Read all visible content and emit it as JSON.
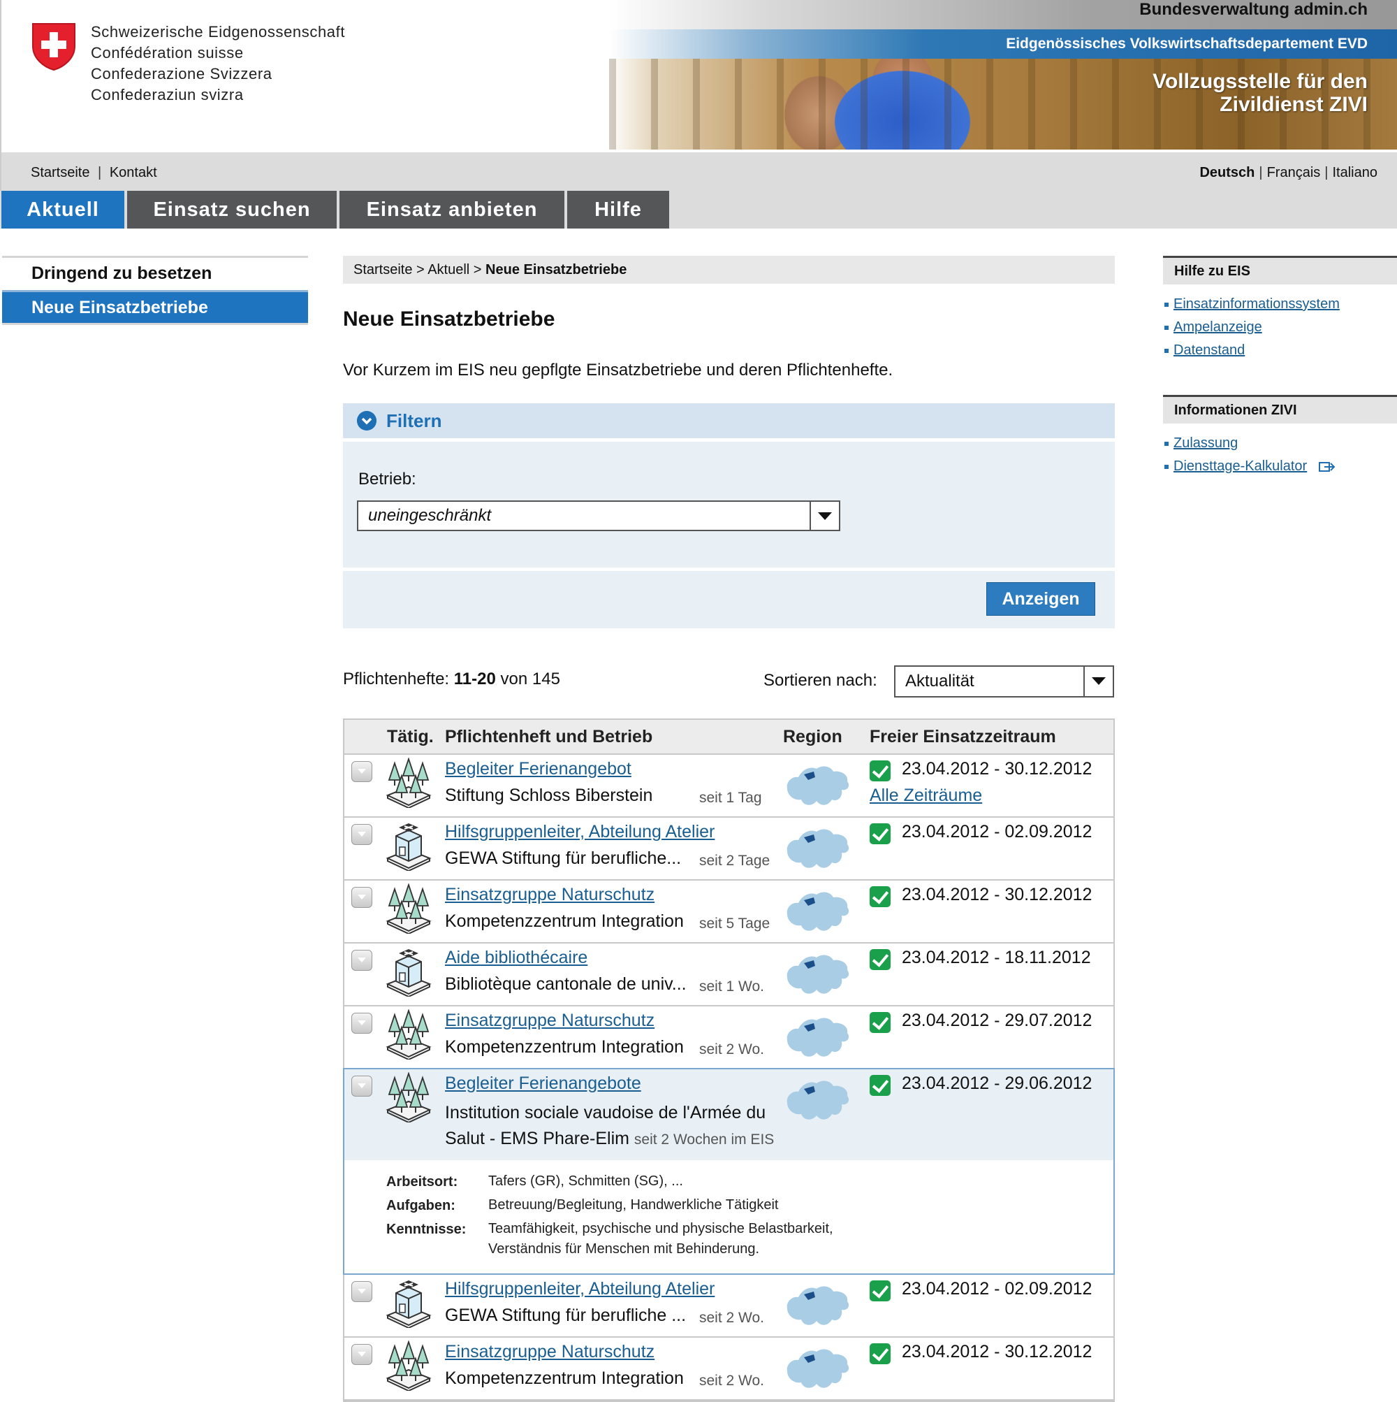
{
  "header": {
    "confederation": [
      "Schweizerische Eidgenossenschaft",
      "Confédération suisse",
      "Confederazione Svizzera",
      "Confederaziun svizra"
    ],
    "admin": "Bundesverwaltung admin.ch",
    "department": "Eidgenössisches Volkswirtschaftsdepartement EVD",
    "office_line1": "Vollzugsstelle für den",
    "office_line2": "Zivildienst ZIVI"
  },
  "service_nav": {
    "startseite": "Startseite",
    "kontakt": "Kontakt",
    "languages": [
      "Deutsch",
      "Français",
      "Italiano"
    ]
  },
  "main_nav": [
    "Aktuell",
    "Einsatz suchen",
    "Einsatz anbieten",
    "Hilfe"
  ],
  "sub_nav": [
    "Dringend zu besetzen",
    "Neue Einsatzbetriebe"
  ],
  "breadcrumb": {
    "home": "Startseite",
    "section": "Aktuell",
    "current": "Neue Einsatzbetriebe",
    "separator": ">"
  },
  "page": {
    "title": "Neue Einsatzbetriebe",
    "intro": "Vor Kurzem im EIS neu gepflgte Einsatzbetriebe und deren Pflichtenhefte."
  },
  "filter": {
    "title": "Filtern",
    "betrieb_label": "Betrieb:",
    "betrieb_value": "uneingeschränkt",
    "submit": "Anzeigen"
  },
  "results": {
    "label": "Pflichtenhefte:",
    "range": "11-20",
    "of": "von",
    "total": "145",
    "sort_label": "Sortieren nach:",
    "sort_value": "Aktualität"
  },
  "table": {
    "headers": {
      "activity": "Tätig.",
      "duty": "Pflichtenheft und Betrieb",
      "region": "Region",
      "period": "Freier Einsatzzeitraum"
    },
    "rows": [
      {
        "icon": "trees-icon",
        "title": "Begleiter Ferienangebot",
        "org": "Stiftung Schloss Biberstein",
        "since": "seit 1 Tag",
        "period": "23.04.2012 - 30.12.2012",
        "extra": "Alle Zeiträume"
      },
      {
        "icon": "building-icon",
        "title": "Hilfsgruppenleiter, Abteilung Atelier",
        "org": "GEWA Stiftung für berufliche...",
        "since": "seit 2 Tage",
        "period": "23.04.2012 - 02.09.2012"
      },
      {
        "icon": "trees-icon",
        "title": "Einsatzgruppe Naturschutz",
        "org": "Kompetenzzentrum Integration",
        "since": "seit 5 Tage",
        "period": "23.04.2012 - 30.12.2012"
      },
      {
        "icon": "building-icon",
        "title": "Aide bibliothécaire",
        "org": "Bibliotèque cantonale de univ...",
        "since": "seit 1 Wo.",
        "period": "23.04.2012 - 18.11.2012"
      },
      {
        "icon": "trees-icon",
        "title": "Einsatzgruppe Naturschutz",
        "org": "Kompetenzzentrum Integration",
        "since": "seit 2 Wo.",
        "period": "23.04.2012 - 29.07.2012"
      }
    ],
    "expanded": {
      "icon": "trees-icon",
      "title": "Begleiter Ferienangebote",
      "org_line1": "Institution sociale vaudoise de l'Armée du",
      "org_line2": "Salut - EMS Phare-Elim",
      "since": "seit 2 Wochen im EIS",
      "period": "23.04.2012 - 29.06.2012",
      "arbeitsort_label": "Arbeitsort:",
      "arbeitsort": "Tafers (GR), Schmitten (SG), ...",
      "aufgaben_label": "Aufgaben:",
      "aufgaben": "Betreuung/Begleitung, Handwerkliche Tätigkeit",
      "kenntnisse_label": "Kenntnisse:",
      "kenntnisse_1": "Teamfähigkeit, psychische und physische Belastbarkeit,",
      "kenntnisse_2": "Verständnis für Menschen mit Behinderung."
    },
    "rows_after": [
      {
        "icon": "building-icon",
        "title": "Hilfsgruppenleiter, Abteilung Atelier",
        "org": "GEWA Stiftung für berufliche ...",
        "since": "seit 2 Wo.",
        "period": "23.04.2012 - 02.09.2012"
      },
      {
        "icon": "trees-icon",
        "title": "Einsatzgruppe Naturschutz",
        "org": "Kompetenzzentrum Integration",
        "since": "seit 2 Wo.",
        "period": "23.04.2012 - 30.12.2012"
      }
    ]
  },
  "sidebar": {
    "hilfe_title": "Hilfe zu EIS",
    "hilfe_links": [
      "Einsatzinformationssystem",
      "Ampelanzeige",
      "Datenstand"
    ],
    "info_title": "Informationen ZIVI",
    "info_links": [
      "Zulassung",
      "Diensttage-Kalkulator"
    ]
  },
  "colors": {
    "accent": "#1f74bf",
    "nav_dark": "#555658",
    "check": "#1aa04a",
    "map": "#a8cde4"
  }
}
